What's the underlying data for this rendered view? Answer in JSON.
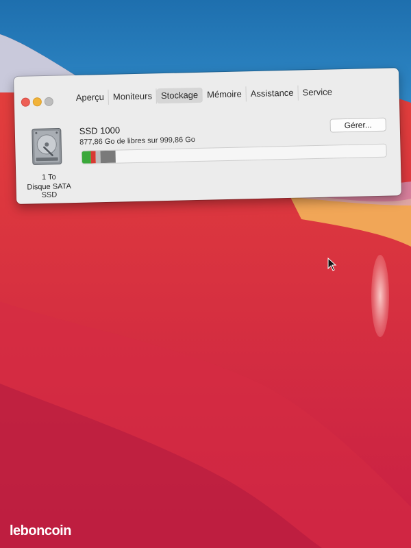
{
  "window": {
    "tabs": [
      {
        "label": "Aperçu",
        "active": false
      },
      {
        "label": "Moniteurs",
        "active": false
      },
      {
        "label": "Stockage",
        "active": true
      },
      {
        "label": "Mémoire",
        "active": false
      },
      {
        "label": "Assistance",
        "active": false
      },
      {
        "label": "Service",
        "active": false
      }
    ]
  },
  "storage": {
    "drive_capacity": "1 To",
    "drive_type": "Disque SATA SSD",
    "volume_name": "SSD 1000",
    "free_text": "877,86 Go de libres sur 999,86 Go",
    "manage_label": "Gérer...",
    "usage_segments": [
      {
        "category": "green",
        "color": "#3aa83a",
        "fraction": 0.03
      },
      {
        "category": "red",
        "color": "#d83a32",
        "fraction": 0.015
      },
      {
        "category": "light-gray",
        "color": "#bdbdbd",
        "fraction": 0.015
      },
      {
        "category": "dark-gray",
        "color": "#7a7a7a",
        "fraction": 0.05
      }
    ],
    "free_color": "#f6f6f6"
  },
  "watermark": "leboncoin",
  "colors": {
    "close": "#ed5f56",
    "minimize": "#f1b33a",
    "zoom": "#bdbdbd"
  }
}
